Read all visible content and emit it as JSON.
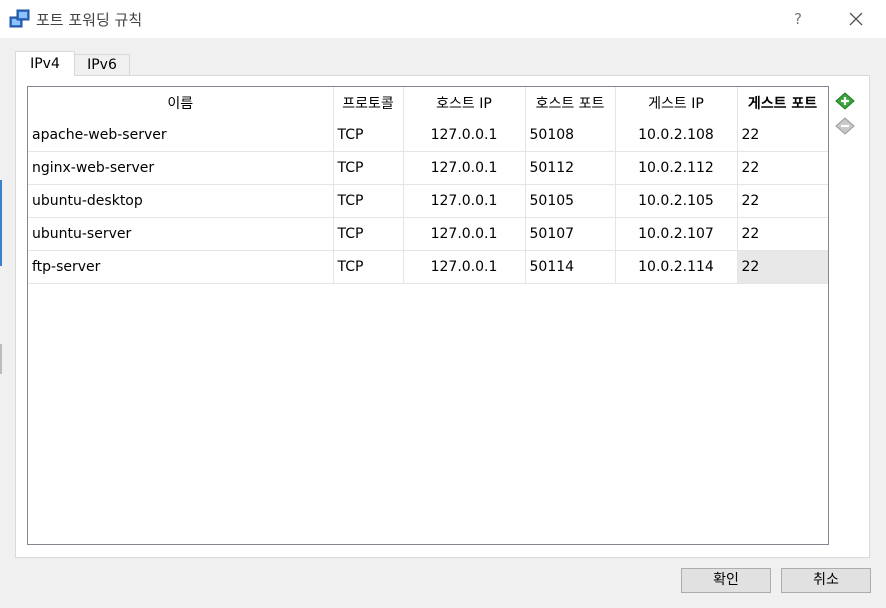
{
  "window": {
    "title": "포트 포워딩 규칙",
    "help_label": "?",
    "icon": "network-window-icon",
    "close_icon": "close-icon"
  },
  "tabs": [
    {
      "label": "IPv4",
      "active": true
    },
    {
      "label": "IPv6",
      "active": false
    }
  ],
  "table": {
    "columns": [
      "이름",
      "프로토콜",
      "호스트 IP",
      "호스트 포트",
      "게스트 IP",
      "게스트 포트"
    ],
    "sorted_column": "게스트 포트",
    "rows": [
      {
        "name": "apache-web-server",
        "protocol": "TCP",
        "host_ip": "127.0.0.1",
        "host_port": "50108",
        "guest_ip": "10.0.2.108",
        "guest_port": "22"
      },
      {
        "name": "nginx-web-server",
        "protocol": "TCP",
        "host_ip": "127.0.0.1",
        "host_port": "50112",
        "guest_ip": "10.0.2.112",
        "guest_port": "22"
      },
      {
        "name": "ubuntu-desktop",
        "protocol": "TCP",
        "host_ip": "127.0.0.1",
        "host_port": "50105",
        "guest_ip": "10.0.2.105",
        "guest_port": "22"
      },
      {
        "name": "ubuntu-server",
        "protocol": "TCP",
        "host_ip": "127.0.0.1",
        "host_port": "50107",
        "guest_ip": "10.0.2.107",
        "guest_port": "22"
      },
      {
        "name": "ftp-server",
        "protocol": "TCP",
        "host_ip": "127.0.0.1",
        "host_port": "50114",
        "guest_ip": "10.0.2.114",
        "guest_port": "22"
      }
    ]
  },
  "side_actions": {
    "add_icon": "add-rule-icon",
    "remove_icon": "remove-rule-icon"
  },
  "buttons": {
    "ok": "확인",
    "cancel": "취소"
  },
  "colors": {
    "accent": "#3c7fd1",
    "add_green": "#3aa53a",
    "selected_cell": "#e8e8e8"
  }
}
